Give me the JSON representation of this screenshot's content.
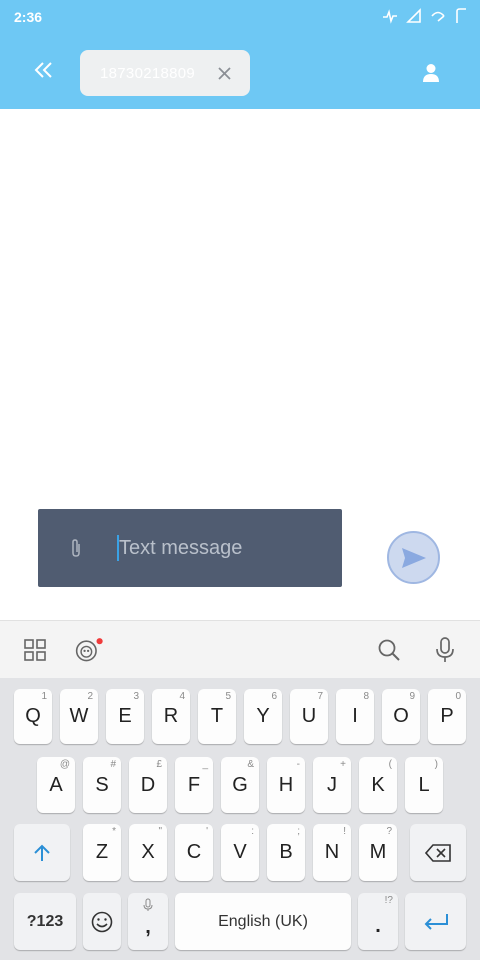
{
  "status_bar": {
    "time": "2:36"
  },
  "header": {
    "recipient": "18730218809"
  },
  "compose": {
    "placeholder": "Text message"
  },
  "keyboard": {
    "row1": [
      {
        "label": "Q",
        "hint": "1"
      },
      {
        "label": "W",
        "hint": "2"
      },
      {
        "label": "E",
        "hint": "3"
      },
      {
        "label": "R",
        "hint": "4"
      },
      {
        "label": "T",
        "hint": "5"
      },
      {
        "label": "Y",
        "hint": "6"
      },
      {
        "label": "U",
        "hint": "7"
      },
      {
        "label": "I",
        "hint": "8"
      },
      {
        "label": "O",
        "hint": "9"
      },
      {
        "label": "P",
        "hint": "0"
      }
    ],
    "row2": [
      {
        "label": "A",
        "hint": "@"
      },
      {
        "label": "S",
        "hint": "#"
      },
      {
        "label": "D",
        "hint": "£"
      },
      {
        "label": "F",
        "hint": "_"
      },
      {
        "label": "G",
        "hint": "&"
      },
      {
        "label": "H",
        "hint": "-"
      },
      {
        "label": "J",
        "hint": "+"
      },
      {
        "label": "K",
        "hint": "("
      },
      {
        "label": "L",
        "hint": ")"
      }
    ],
    "row3": [
      {
        "label": "Z",
        "hint": "*"
      },
      {
        "label": "X",
        "hint": "\""
      },
      {
        "label": "C",
        "hint": "'"
      },
      {
        "label": "V",
        "hint": ":"
      },
      {
        "label": "B",
        "hint": ";"
      },
      {
        "label": "N",
        "hint": "!"
      },
      {
        "label": "M",
        "hint": "?"
      }
    ],
    "symbols_label": "?123",
    "comma_label": ",",
    "space_label": "English (UK)",
    "period_label": ".",
    "period_hint": "!?"
  },
  "colors": {
    "header_bg": "#6ec8f4",
    "compose_bg": "#505c71",
    "accent": "#3aa2e6"
  }
}
